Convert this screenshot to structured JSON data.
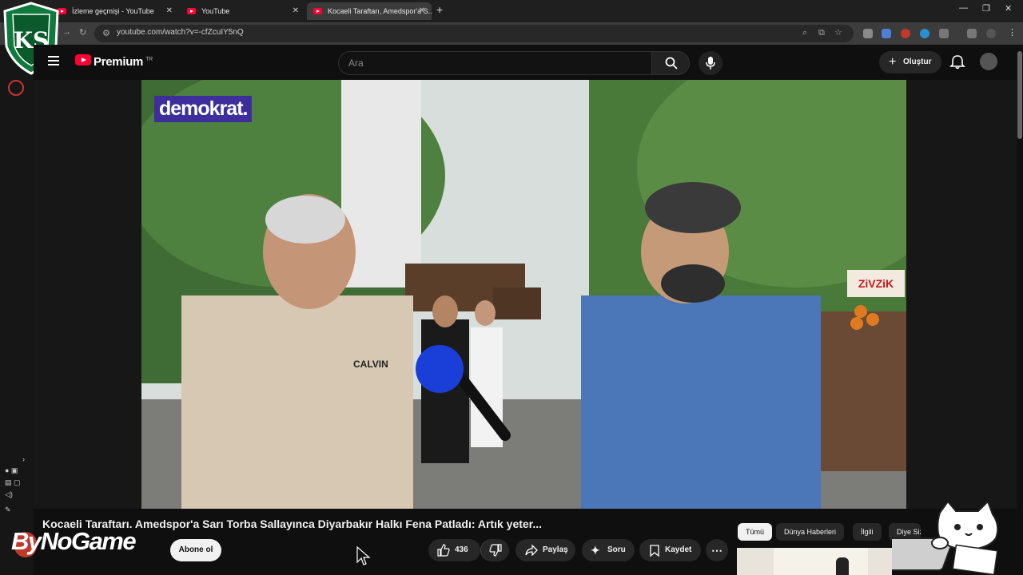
{
  "tabs": [
    {
      "label": "İzleme geçmişi - YouTube"
    },
    {
      "label": "YouTube"
    },
    {
      "label": "Kocaeli Taraftarı, Amedspor'a S..."
    }
  ],
  "address": {
    "url": "youtube.com/watch?v=-cfZcuIY5nQ"
  },
  "header": {
    "brand": "Premium",
    "brand_sup": "TR",
    "search_placeholder": "Ara",
    "create_label": "Oluştur"
  },
  "video": {
    "watermark": "demokrat.",
    "sign": "ZiVZiK",
    "shirt_text": "CALVIN"
  },
  "title": "Kocaeli Taraftarı. Amedspor'a Sarı Torba Sallayınca Diyarbakır Halkı Fena Patladı: Artık yeter...",
  "channel": {
    "name_overlay": "ByNoGame",
    "subscribe_label": "Abone ol"
  },
  "actions": {
    "like_count": "436",
    "share_label": "Paylaş",
    "ask_label": "Soru",
    "save_label": "Kaydet"
  },
  "chips": [
    {
      "label": "Tümü"
    },
    {
      "label": "Dünya Haberleri"
    },
    {
      "label": "İlgili"
    },
    {
      "label": "Diye Siz"
    }
  ],
  "logo_text": "KS"
}
